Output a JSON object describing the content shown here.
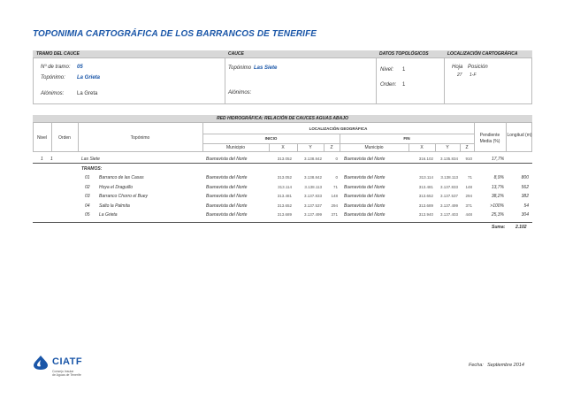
{
  "title": "TOPONIMIA CARTOGRÁFICA DE LOS BARRANCOS DE TENERIFE",
  "sections": {
    "tramo": "TRAMO DEL CAUCE",
    "cauce": "CAUCE",
    "datos": "DATOS TOPOLÓGICOS",
    "localizacion": "LOCALIZACIÓN CARTOGRÁFICA"
  },
  "tramo": {
    "numero_label": "Nº de tramo:",
    "numero": "05",
    "toponimo_label": "Topónimo:",
    "toponimo": "La Grieta",
    "alonimos_label": "Alónimos:",
    "alonimos": "La Greta"
  },
  "cauce": {
    "toponimo_label": "Topónimo",
    "toponimo": "Las Siete",
    "alonimos_label": "Alónimos:"
  },
  "datos": {
    "nivel_label": "Nivel:",
    "nivel": "1",
    "orden_label": "Orden:",
    "orden": "1"
  },
  "localizacion": {
    "hoja_label": "Hoja",
    "posicion_label": "Posición",
    "hoja": "27",
    "posicion": "1-F"
  },
  "red": {
    "title": "RED HIDROGRÁFICA: RELACIÓN DE CAUCES AGUAS ABAJO",
    "headers": {
      "nivel": "Nivel",
      "orden": "Orden",
      "toponimo": "Topónimo",
      "loc_geo": "LOCALIZACIÓN GEOGRÁFICA",
      "inicio": "INICIO",
      "fin": "FIN",
      "municipio": "Municipio",
      "x": "X",
      "y": "Y",
      "z": "Z",
      "pendiente": "Pendiente Media (%)",
      "longitud": "Longitud (m)"
    },
    "main_row": {
      "nivel": "1",
      "orden": "1",
      "toponimo": "Las Siete",
      "mun_i": "Buenavista del Norte",
      "xi": "313.052",
      "yi": "3.138.842",
      "zi": "0",
      "mun_f": "Buenavista del Norte",
      "xf": "316.102",
      "yf": "3.135.834",
      "zf": "910",
      "pend": "17,7%",
      "long": ""
    },
    "tramos_label": "TRAMOS:",
    "tramos": [
      {
        "n": "01",
        "toponimo": "Barranco de las Casas",
        "mun_i": "Buenavista del Norte",
        "xi": "313.052",
        "yi": "3.138.842",
        "zi": "0",
        "mun_f": "Buenavista del Norte",
        "xf": "313.114",
        "yf": "3.138.113",
        "zf": "71",
        "pend": "8,9%",
        "long": "800",
        "hl": false
      },
      {
        "n": "02",
        "toponimo": "Hoya el Draguillo",
        "mun_i": "Buenavista del Norte",
        "xi": "313.114",
        "yi": "3.138.113",
        "zi": "71",
        "mun_f": "Buenavista del Norte",
        "xf": "313.481",
        "yf": "3.137.833",
        "zf": "148",
        "pend": "13,7%",
        "long": "562",
        "hl": false
      },
      {
        "n": "03",
        "toponimo": "Barranco Chorro el Buey",
        "mun_i": "Buenavista del Norte",
        "xi": "313.481",
        "yi": "3.137.833",
        "zi": "148",
        "mun_f": "Buenavista del Norte",
        "xf": "313.652",
        "yf": "3.137.537",
        "zf": "294",
        "pend": "38,2%",
        "long": "382",
        "hl": false
      },
      {
        "n": "04",
        "toponimo": "Salto la Palmita",
        "mun_i": "Buenavista del Norte",
        "xi": "313.652",
        "yi": "3.137.537",
        "zi": "294",
        "mun_f": "Buenavista del Norte",
        "xf": "313.689",
        "yf": "3.137.499",
        "zf": "371",
        "pend": ">100%",
        "long": "54",
        "hl": false
      },
      {
        "n": "05",
        "toponimo": "La Grieta",
        "mun_i": "Buenavista del Norte",
        "xi": "313.689",
        "yi": "3.137.499",
        "zi": "371",
        "mun_f": "Buenavista del Norte",
        "xf": "313.940",
        "yf": "3.137.403",
        "zf": "448",
        "pend": "25,3%",
        "long": "304",
        "hl": true
      }
    ],
    "suma_label": "Suma:",
    "suma": "2.102"
  },
  "footer": {
    "logo": "CIATF",
    "logo_sub1": "Consejo Insular",
    "logo_sub2": "de Aguas de Tenerife",
    "fecha_label": "Fecha:",
    "fecha": "Septiembre  2014"
  }
}
